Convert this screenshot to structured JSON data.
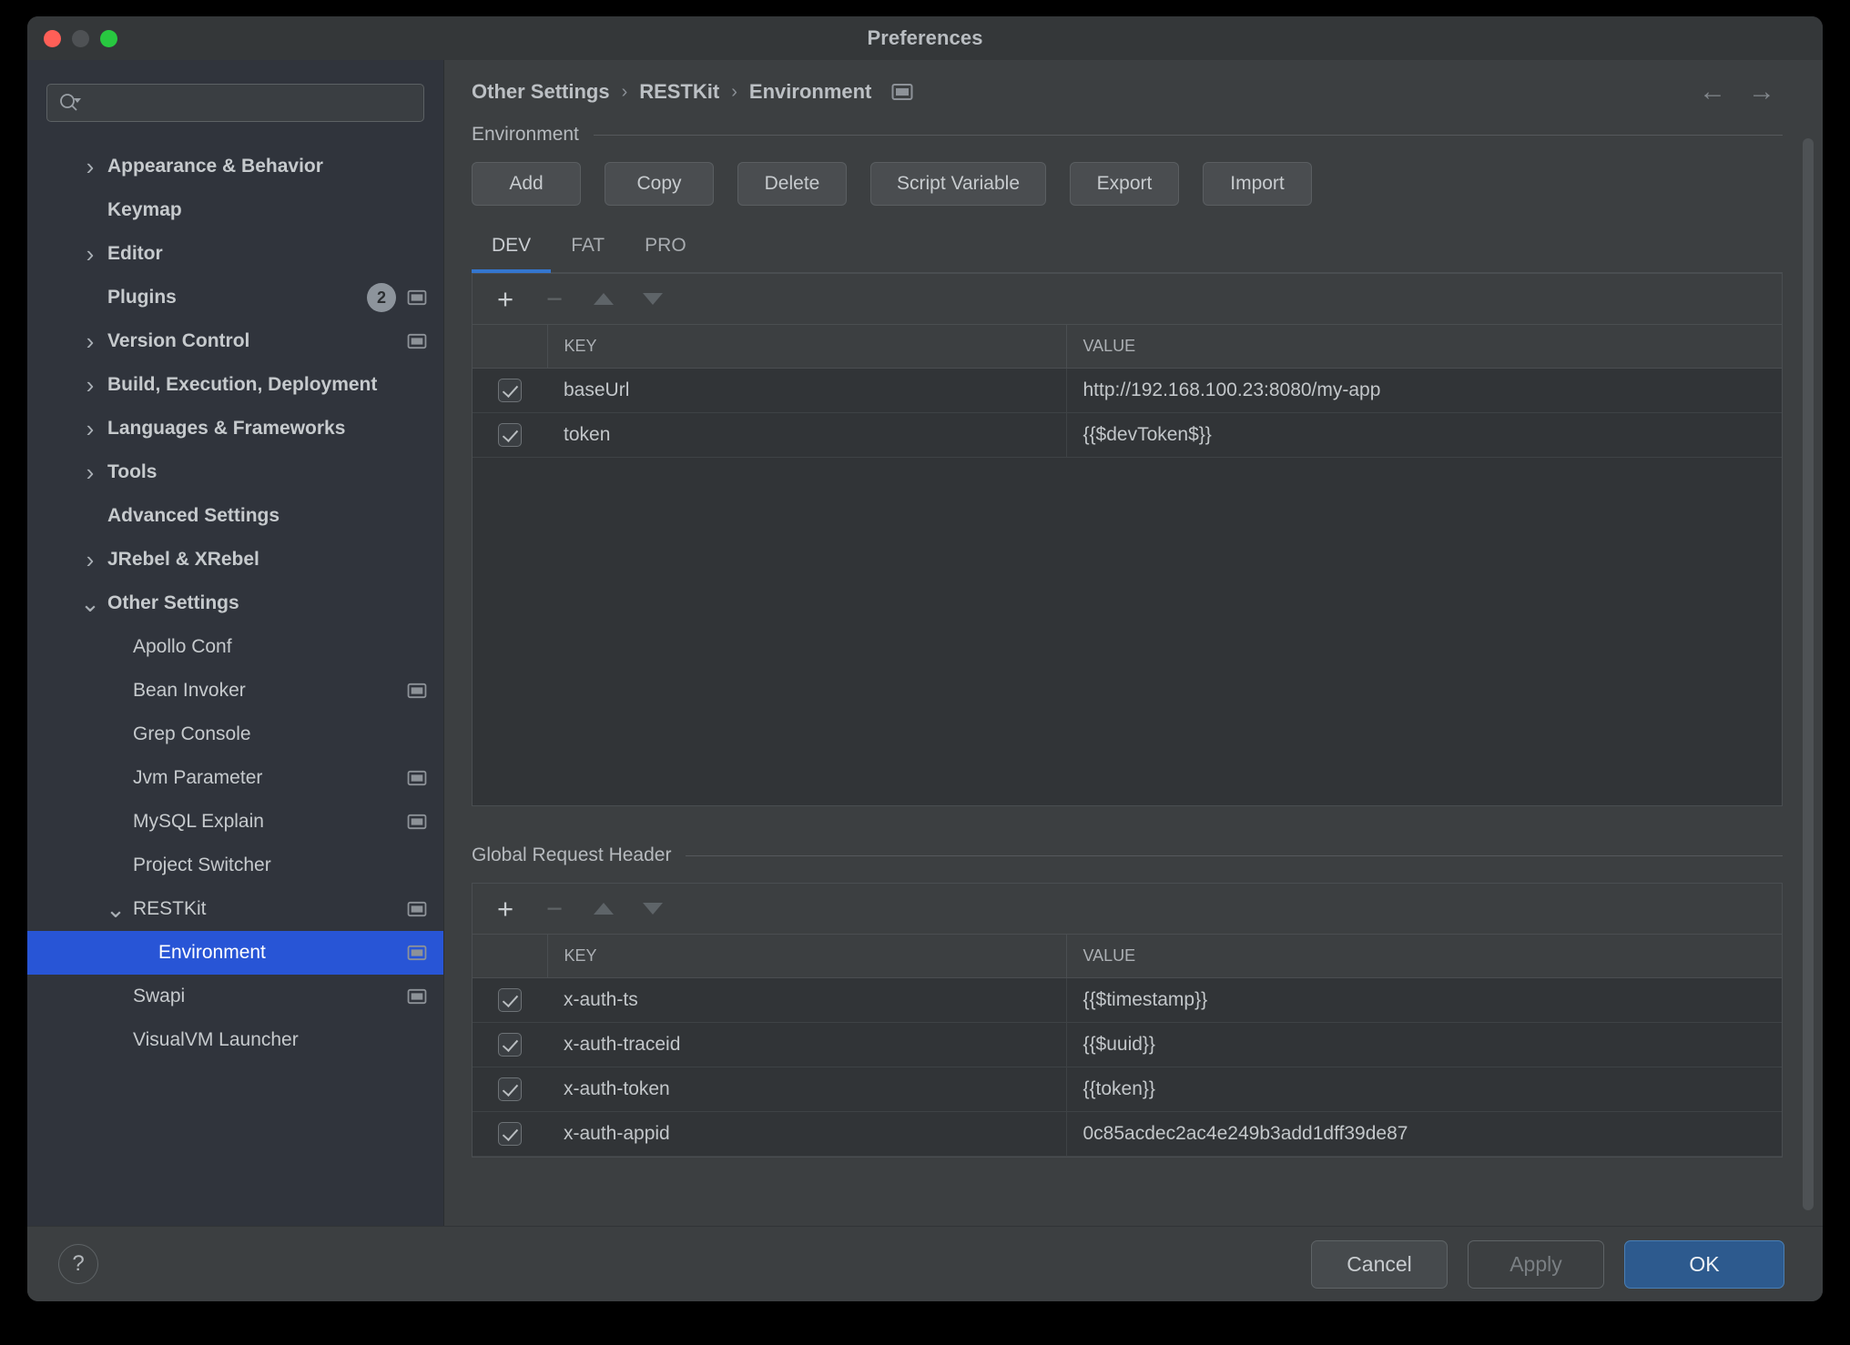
{
  "window": {
    "title": "Preferences",
    "traffic_lights": [
      "close-button",
      "minimize-button",
      "maximize-button"
    ]
  },
  "sidebar": {
    "search": {
      "value": "",
      "placeholder": "",
      "icon": "search-icon"
    },
    "items": [
      {
        "label": "Appearance & Behavior",
        "depth": 0,
        "chevron": "right",
        "selected": false,
        "badge": null,
        "panel_icon": false
      },
      {
        "label": "Keymap",
        "depth": 0,
        "chevron": "",
        "selected": false,
        "badge": null,
        "panel_icon": false
      },
      {
        "label": "Editor",
        "depth": 0,
        "chevron": "right",
        "selected": false,
        "badge": null,
        "panel_icon": false
      },
      {
        "label": "Plugins",
        "depth": 0,
        "chevron": "",
        "selected": false,
        "badge": "2",
        "panel_icon": true
      },
      {
        "label": "Version Control",
        "depth": 0,
        "chevron": "right",
        "selected": false,
        "badge": null,
        "panel_icon": true
      },
      {
        "label": "Build, Execution, Deployment",
        "depth": 0,
        "chevron": "right",
        "selected": false,
        "badge": null,
        "panel_icon": false
      },
      {
        "label": "Languages & Frameworks",
        "depth": 0,
        "chevron": "right",
        "selected": false,
        "badge": null,
        "panel_icon": false
      },
      {
        "label": "Tools",
        "depth": 0,
        "chevron": "right",
        "selected": false,
        "badge": null,
        "panel_icon": false
      },
      {
        "label": "Advanced Settings",
        "depth": 0,
        "chevron": "",
        "selected": false,
        "badge": null,
        "panel_icon": false
      },
      {
        "label": "JRebel & XRebel",
        "depth": 0,
        "chevron": "right",
        "selected": false,
        "badge": null,
        "panel_icon": false
      },
      {
        "label": "Other Settings",
        "depth": 0,
        "chevron": "down",
        "selected": false,
        "badge": null,
        "panel_icon": false
      },
      {
        "label": "Apollo Conf",
        "depth": 1,
        "chevron": "",
        "selected": false,
        "badge": null,
        "panel_icon": false
      },
      {
        "label": "Bean Invoker",
        "depth": 1,
        "chevron": "",
        "selected": false,
        "badge": null,
        "panel_icon": true
      },
      {
        "label": "Grep Console",
        "depth": 1,
        "chevron": "",
        "selected": false,
        "badge": null,
        "panel_icon": false
      },
      {
        "label": "Jvm Parameter",
        "depth": 1,
        "chevron": "",
        "selected": false,
        "badge": null,
        "panel_icon": true
      },
      {
        "label": "MySQL Explain",
        "depth": 1,
        "chevron": "",
        "selected": false,
        "badge": null,
        "panel_icon": true
      },
      {
        "label": "Project Switcher",
        "depth": 1,
        "chevron": "",
        "selected": false,
        "badge": null,
        "panel_icon": false
      },
      {
        "label": "RESTKit",
        "depth": 1,
        "chevron": "down",
        "selected": false,
        "badge": null,
        "panel_icon": true
      },
      {
        "label": "Environment",
        "depth": 2,
        "chevron": "",
        "selected": true,
        "badge": null,
        "panel_icon": true
      },
      {
        "label": "Swapi",
        "depth": 1,
        "chevron": "",
        "selected": false,
        "badge": null,
        "panel_icon": true
      },
      {
        "label": "VisualVM Launcher",
        "depth": 1,
        "chevron": "",
        "selected": false,
        "badge": null,
        "panel_icon": false
      }
    ]
  },
  "breadcrumb": {
    "items": [
      "Other Settings",
      "RESTKit",
      "Environment"
    ],
    "separator": "›",
    "trailing_icon": "panel-icon",
    "back_icon": "arrow-left-icon",
    "forward_icon": "arrow-right-icon"
  },
  "environment_section": {
    "title": "Environment",
    "buttons": [
      "Add",
      "Copy",
      "Delete",
      "Script Variable",
      "Export",
      "Import"
    ],
    "tabs": [
      {
        "label": "DEV",
        "active": true
      },
      {
        "label": "FAT",
        "active": false
      },
      {
        "label": "PRO",
        "active": false
      }
    ],
    "toolbar_icons": [
      "add-icon",
      "remove-icon",
      "move-up-icon",
      "move-down-icon"
    ],
    "columns": [
      "KEY",
      "VALUE"
    ],
    "rows": [
      {
        "checked": true,
        "key": "baseUrl",
        "value": "http://192.168.100.23:8080/my-app"
      },
      {
        "checked": true,
        "key": "token",
        "value": "{{$devToken$}}"
      }
    ]
  },
  "global_header_section": {
    "title": "Global Request Header",
    "toolbar_icons": [
      "add-icon",
      "remove-icon",
      "move-up-icon",
      "move-down-icon"
    ],
    "columns": [
      "KEY",
      "VALUE"
    ],
    "rows": [
      {
        "checked": true,
        "key": "x-auth-ts",
        "value": "{{$timestamp}}"
      },
      {
        "checked": true,
        "key": "x-auth-traceid",
        "value": "{{$uuid}}"
      },
      {
        "checked": true,
        "key": "x-auth-token",
        "value": "{{token}}"
      },
      {
        "checked": true,
        "key": "x-auth-appid",
        "value": "0c85acdec2ac4e249b3add1dff39de87"
      }
    ]
  },
  "footer": {
    "help_label": "?",
    "cancel_label": "Cancel",
    "apply_label": "Apply",
    "apply_enabled": false,
    "ok_label": "OK"
  },
  "colors": {
    "window_bg": "#3c3f41",
    "sidebar_bg": "#30343c",
    "selection_blue": "#2855d6",
    "tab_accent": "#3476cf",
    "primary_button": "#2d5a8e",
    "table_bg": "#313437"
  }
}
